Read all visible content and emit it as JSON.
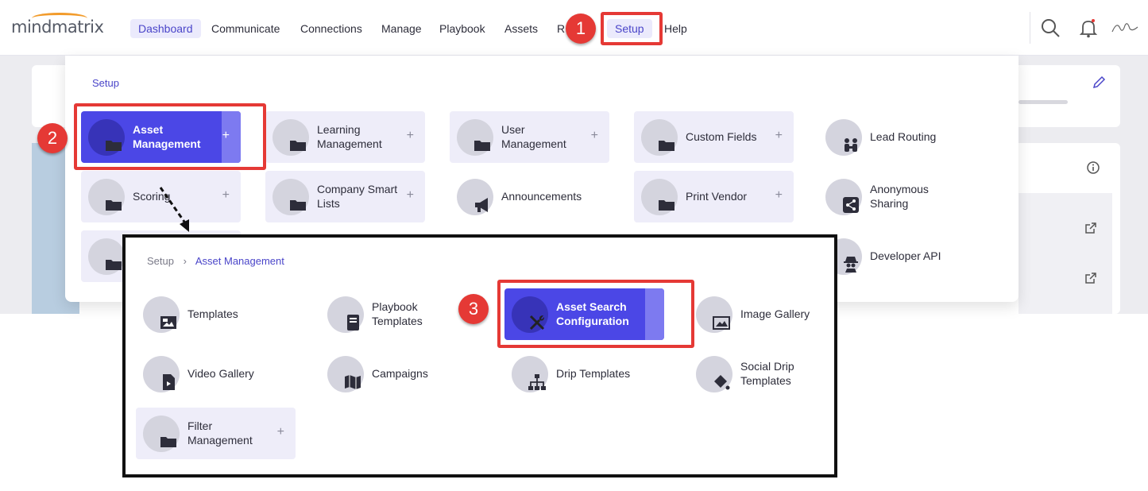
{
  "logo": {
    "text": "mindmatrix"
  },
  "nav": {
    "dashboard": "Dashboard",
    "communicate": "Communicate",
    "connections": "Connections",
    "manage": "Manage",
    "playbook": "Playbook",
    "assets": "Assets",
    "reports": "R",
    "setup": "Setup",
    "help": "Help"
  },
  "steps": {
    "one": "1",
    "two": "2",
    "three": "3"
  },
  "menu": {
    "crumb": "Setup",
    "tiles": {
      "asset_management": "Asset Management",
      "learning_management": "Learning Management",
      "user_management": "User Management",
      "custom_fields": "Custom Fields",
      "lead_routing": "Lead Routing",
      "scoring": "Scoring",
      "company_smart_lists": "Company Smart Lists",
      "announcements": "Announcements",
      "print_vendor": "Print Vendor",
      "anonymous_sharing": "Anonymous Sharing",
      "developer_api": "Developer API"
    },
    "plus": "+"
  },
  "zoom": {
    "crumb_root": "Setup",
    "crumb_sep": "›",
    "crumb_current": "Asset Management",
    "tiles": {
      "templates": "Templates",
      "playbook_templates": "Playbook Templates",
      "asset_search_configuration": "Asset Search Configuration",
      "image_gallery": "Image Gallery",
      "video_gallery": "Video Gallery",
      "campaigns": "Campaigns",
      "drip_templates": "Drip Templates",
      "social_drip_templates": "Social Drip Templates",
      "filter_management": "Filter Management"
    },
    "plus": "+"
  },
  "icons": {
    "search": "search-icon",
    "bell": "bell-icon",
    "avatar": "signature-avatar",
    "folder": "folder-icon",
    "megaphone": "megaphone-icon",
    "people": "people-icon",
    "share": "share-icon",
    "spy": "spy-icon",
    "tools": "tools-icon",
    "image": "image-icon",
    "video": "video-file-icon",
    "map": "map-icon",
    "book": "book-icon",
    "sitemap": "sitemap-icon",
    "paint": "paint-bucket-icon"
  },
  "colors": {
    "accent": "#4b47e6",
    "highlight": "#e53935",
    "brand_arc": "#f29b2b"
  }
}
